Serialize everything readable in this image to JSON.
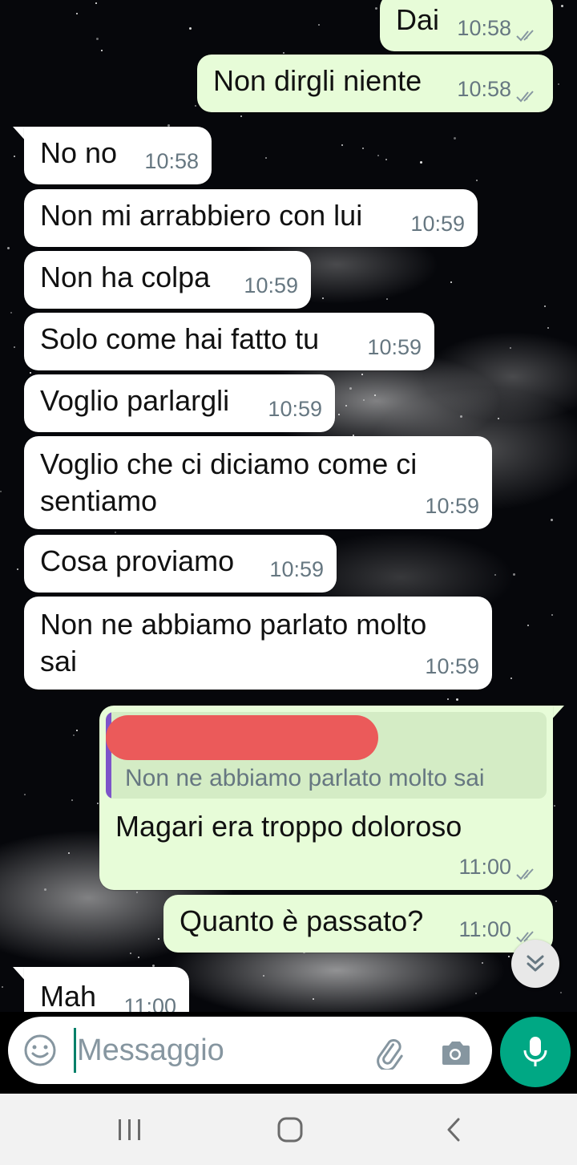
{
  "messages": [
    {
      "dir": "out",
      "text": "Dai",
      "time": "10:58",
      "ticks": "read"
    },
    {
      "dir": "out",
      "text": "Non dirgli niente",
      "time": "10:58",
      "ticks": "read"
    },
    {
      "dir": "in",
      "text": "No no",
      "time": "10:58"
    },
    {
      "dir": "in",
      "text": "Non mi arrabbiero con lui",
      "time": "10:59"
    },
    {
      "dir": "in",
      "text": "Non ha colpa",
      "time": "10:59"
    },
    {
      "dir": "in",
      "text": "Solo come hai fatto tu",
      "time": "10:59"
    },
    {
      "dir": "in",
      "text": "Voglio parlargli",
      "time": "10:59"
    },
    {
      "dir": "in",
      "text": "Voglio che ci diciamo come ci sentiamo",
      "time": "10:59"
    },
    {
      "dir": "in",
      "text": "Cosa proviamo",
      "time": "10:59"
    },
    {
      "dir": "in",
      "text": "Non ne abbiamo parlato molto sai",
      "time": "10:59"
    },
    {
      "dir": "out",
      "text": "Magari era troppo doloroso",
      "time": "11:00",
      "ticks": "read",
      "reply_to": {
        "author": "(redacted)",
        "text": "Non ne abbiamo parlato molto sai"
      }
    },
    {
      "dir": "out",
      "text": "Quanto è passato?",
      "time": "11:00",
      "ticks": "read"
    },
    {
      "dir": "in",
      "text": "Mah",
      "time": "11:00"
    }
  ],
  "compose": {
    "placeholder": "Messaggio"
  },
  "icons": {
    "emoji": "emoji-icon",
    "attach": "paperclip-icon",
    "camera": "camera-icon",
    "mic": "microphone-icon",
    "scroll": "double-chevron-down-icon",
    "nav_recents": "recents-icon",
    "nav_home": "home-icon",
    "nav_back": "back-icon"
  },
  "colors": {
    "incoming_bubble": "#ffffff",
    "outgoing_bubble": "#e7fcd8",
    "accent": "#00a884",
    "read_ticks": "#8696a0",
    "quote_bar": "#7d54c9",
    "redaction": "#eb5a5a"
  }
}
